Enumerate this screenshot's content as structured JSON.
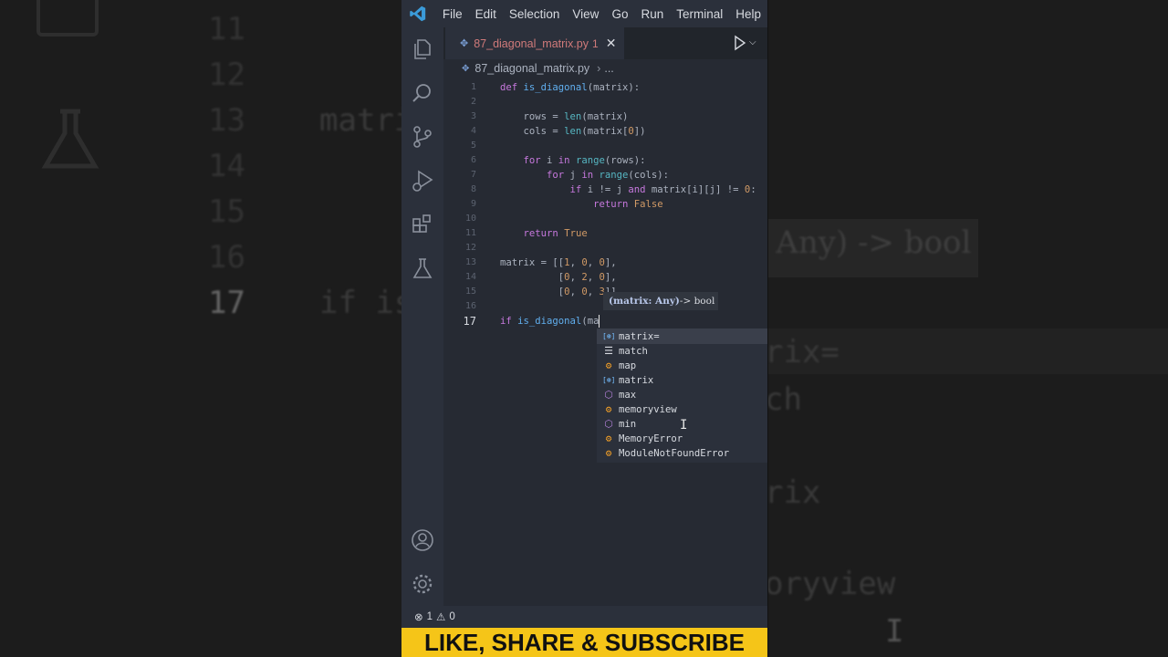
{
  "menu": [
    "File",
    "Edit",
    "Selection",
    "View",
    "Go",
    "Run",
    "Terminal",
    "Help"
  ],
  "tab": {
    "label": "87_diagonal_matrix.py",
    "badge": "1",
    "close": "✕"
  },
  "breadcrumb": {
    "file": "87_diagonal_matrix.py",
    "more": "..."
  },
  "code_lines": [
    {
      "n": "1",
      "text": "def is_diagonal(matrix):"
    },
    {
      "n": "2",
      "text": ""
    },
    {
      "n": "3",
      "text": "    rows = len(matrix)"
    },
    {
      "n": "4",
      "text": "    cols = len(matrix[0])"
    },
    {
      "n": "5",
      "text": ""
    },
    {
      "n": "6",
      "text": "    for i in range(rows):"
    },
    {
      "n": "7",
      "text": "        for j in range(cols):"
    },
    {
      "n": "8",
      "text": "            if i != j and matrix[i][j] != 0:"
    },
    {
      "n": "9",
      "text": "                return False"
    },
    {
      "n": "10",
      "text": ""
    },
    {
      "n": "11",
      "text": "    return True"
    },
    {
      "n": "12",
      "text": ""
    },
    {
      "n": "13",
      "text": "matrix = [[1, 0, 0],"
    },
    {
      "n": "14",
      "text": "          [0, 2, 0],"
    },
    {
      "n": "15",
      "text": "          [0, 0, 3]]"
    },
    {
      "n": "16",
      "text": ""
    },
    {
      "n": "17",
      "text": "if is_diagonal(ma"
    }
  ],
  "current_line": "17",
  "signature_hint": {
    "param": "(matrix: Any)",
    "returns": " -> bool"
  },
  "suggestions": [
    {
      "label": "matrix=",
      "kind": "variable",
      "icon": "variable-icon",
      "selected": true
    },
    {
      "label": "match",
      "kind": "keyword",
      "icon": "keyword-icon",
      "selected": false
    },
    {
      "label": "map",
      "kind": "function",
      "icon": "function-icon",
      "selected": false
    },
    {
      "label": "matrix",
      "kind": "variable",
      "icon": "variable-icon",
      "selected": false
    },
    {
      "label": "max",
      "kind": "class",
      "icon": "class-icon",
      "selected": false
    },
    {
      "label": "memoryview",
      "kind": "function",
      "icon": "function-icon",
      "selected": false
    },
    {
      "label": "min",
      "kind": "class",
      "icon": "class-icon",
      "selected": false
    },
    {
      "label": "MemoryError",
      "kind": "function",
      "icon": "function-icon",
      "selected": false
    },
    {
      "label": "ModuleNotFoundError",
      "kind": "function",
      "icon": "function-icon",
      "selected": false
    }
  ],
  "status": {
    "errors": "1",
    "warnings": "0"
  },
  "banner": "LIKE, SHARE & SUBSCRIBE",
  "background_left_numbers": [
    "11",
    "12",
    "13",
    "14",
    "15",
    "16",
    "17"
  ],
  "background_left_code": [
    "matrix",
    "if is"
  ],
  "background_right_text": [
    ": Any) -> bool",
    "rix=",
    "ch",
    "rix",
    "oryview"
  ],
  "colors": {
    "editor_bg": "#262a33",
    "banner": "#f5c518",
    "keyword": "#c678dd",
    "function": "#61afef",
    "number": "#d19a66"
  }
}
